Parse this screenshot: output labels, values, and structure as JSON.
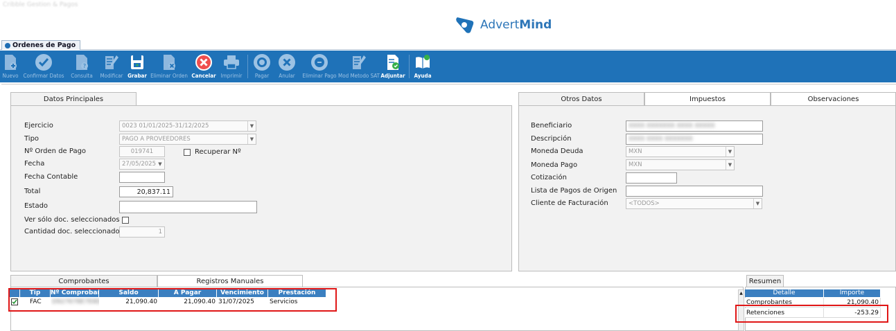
{
  "header": {
    "top_left_text": "Cribble Gestion & Pagos",
    "brand_part1": "Advert",
    "brand_part2": "Mind",
    "brand_color": "#2d76b8"
  },
  "window_tab": {
    "title": "Ordenes de Pago"
  },
  "toolbar": {
    "background": "#1f72b8",
    "buttons": [
      {
        "label": "Nuevo",
        "icon": "document-add-icon",
        "active": false
      },
      {
        "label": "Confirmar Datos",
        "icon": "check-circle-icon",
        "active": false
      },
      {
        "label": "Consulta",
        "icon": "document-search-icon",
        "active": false
      },
      {
        "label": "Modificar",
        "icon": "edit-document-icon",
        "active": false
      },
      {
        "label": "Grabar",
        "icon": "save-disk-icon",
        "active": true
      },
      {
        "label": "Eliminar Orden",
        "icon": "document-delete-icon",
        "active": false
      },
      {
        "label": "Cancelar",
        "icon": "cancel-circle-icon",
        "active": true
      },
      {
        "label": "Imprimir",
        "icon": "printer-icon",
        "active": false
      },
      {
        "label": "Pagar",
        "icon": "pay-coin-icon",
        "active": false
      },
      {
        "label": "Anular",
        "icon": "x-circle-icon",
        "active": false
      },
      {
        "label": "Eliminar Pago",
        "icon": "delete-pay-icon",
        "active": false
      },
      {
        "label": "Mod Metodo SAT",
        "icon": "edit-method-icon",
        "active": false
      },
      {
        "label": "Adjuntar",
        "icon": "attach-document-icon",
        "active": true
      },
      {
        "label": "Ayuda",
        "icon": "help-book-icon",
        "active": true
      }
    ]
  },
  "main_tabs": {
    "datos_principales": "Datos Principales"
  },
  "datos": {
    "ejercicio_label": "Ejercicio",
    "ejercicio_value": "0023 01/01/2025-31/12/2025",
    "tipo_label": "Tipo",
    "tipo_value": "PAGO A PROVEEDORES",
    "orden_label": "Nº Orden de Pago",
    "orden_value": "019741",
    "recuperar_label": "Recuperar Nº",
    "fecha_label": "Fecha",
    "fecha_value": "27/05/2025",
    "fecha_contable_label": "Fecha Contable",
    "fecha_contable_value": "",
    "total_label": "Total",
    "total_value": "20,837.11",
    "estado_label": "Estado",
    "estado_value": "",
    "ver_solo_label": "Ver sólo doc. seleccionados",
    "cantidad_label": "Cantidad doc. seleccionados",
    "cantidad_value": "1"
  },
  "other_tabs": {
    "otros_datos": "Otros Datos",
    "impuestos": "Impuestos",
    "observaciones": "Observaciones"
  },
  "otros": {
    "beneficiario_label": "Beneficiario",
    "beneficiario_value": "XXXX XXXXXXX XXXX XXXXX",
    "descripcion_label": "Descripción",
    "descripcion_value": "XXXX XXXX XXXXXXX",
    "moneda_deuda_label": "Moneda Deuda",
    "moneda_deuda_value": "MXN",
    "moneda_pago_label": "Moneda Pago",
    "moneda_pago_value": "MXN",
    "cotizacion_label": "Cotización",
    "cotizacion_value": "",
    "lista_pagos_label": "Lista de Pagos de Origen",
    "lista_pagos_value": "",
    "cliente_label": "Cliente de Facturación",
    "cliente_value": "<TODOS>"
  },
  "bottom_tabs": {
    "comprobantes": "Comprobantes",
    "registros": "Registros Manuales"
  },
  "grid": {
    "columns": [
      "Tip",
      "Nº Comprobante",
      "Saldo",
      "A Pagar",
      "Vencimiento",
      "Prestación"
    ],
    "rows": [
      {
        "tip": "FAC",
        "numero": "D927678E7E8D",
        "saldo": "21,090.40",
        "a_pagar": "21,090.40",
        "vencimiento": "31/07/2025",
        "prestacion": "Servicios"
      }
    ]
  },
  "resumen": {
    "tab": "Resumen",
    "columns": [
      "Detalle",
      "Importe"
    ],
    "rows": [
      {
        "detalle": "Comprobantes",
        "importe": "21,090.40"
      },
      {
        "detalle": "Retenciones",
        "importe": "-253.29"
      }
    ]
  },
  "highlight_color": "#e01616"
}
